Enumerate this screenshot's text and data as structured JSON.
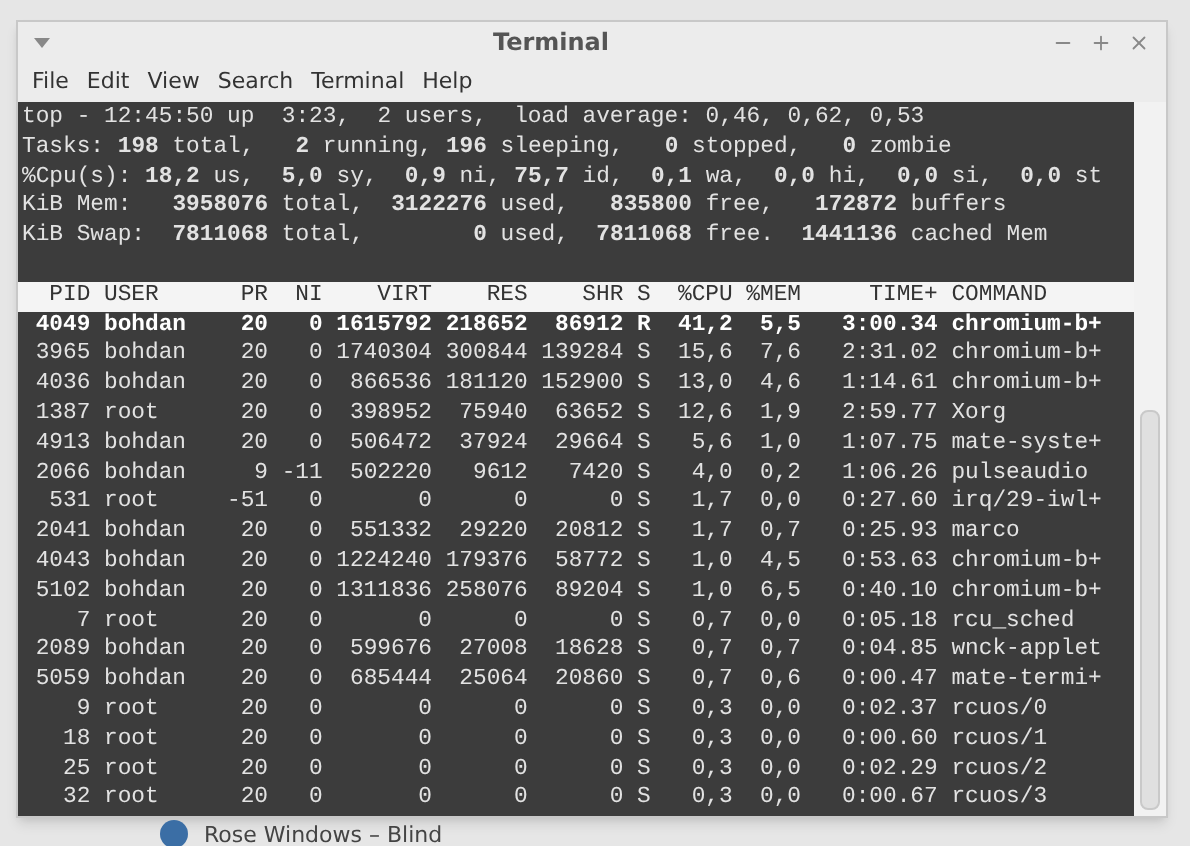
{
  "window": {
    "title": "Terminal"
  },
  "menu": [
    "File",
    "Edit",
    "View",
    "Search",
    "Terminal",
    "Help"
  ],
  "summary": [
    "top - 12:45:50 up  3:23,  2 users,  load average: 0,46, 0,62, 0,53",
    "Tasks: **198** total,   **2** running, **196** sleeping,   **0** stopped,   **0** zombie",
    "%Cpu(s): **18,2** us,  **5,0** sy,  **0,9** ni, **75,7** id,  **0,1** wa,  **0,0** hi,  **0,0** si,  **0,0** st",
    "KiB Mem:   **3958076** total,  **3122276** used,   **835800** free,   **172872** buffers",
    "KiB Swap:  **7811068** total,        **0** used,  **7811068** free.  **1441136** cached Mem"
  ],
  "table": {
    "columns": [
      "PID",
      "USER",
      "PR",
      "NI",
      "VIRT",
      "RES",
      "SHR",
      "S",
      "%CPU",
      "%MEM",
      "TIME+",
      "COMMAND"
    ],
    "rows": [
      {
        "highlighted": true,
        "cells": [
          "4049",
          "bohdan",
          "20",
          "0",
          "1615792",
          "218652",
          "86912",
          "R",
          "41,2",
          "5,5",
          "3:00.34",
          "chromium-b+"
        ]
      },
      {
        "highlighted": false,
        "cells": [
          "3965",
          "bohdan",
          "20",
          "0",
          "1740304",
          "300844",
          "139284",
          "S",
          "15,6",
          "7,6",
          "2:31.02",
          "chromium-b+"
        ]
      },
      {
        "highlighted": false,
        "cells": [
          "4036",
          "bohdan",
          "20",
          "0",
          "866536",
          "181120",
          "152900",
          "S",
          "13,0",
          "4,6",
          "1:14.61",
          "chromium-b+"
        ]
      },
      {
        "highlighted": false,
        "cells": [
          "1387",
          "root",
          "20",
          "0",
          "398952",
          "75940",
          "63652",
          "S",
          "12,6",
          "1,9",
          "2:59.77",
          "Xorg"
        ]
      },
      {
        "highlighted": false,
        "cells": [
          "4913",
          "bohdan",
          "20",
          "0",
          "506472",
          "37924",
          "29664",
          "S",
          "5,6",
          "1,0",
          "1:07.75",
          "mate-syste+"
        ]
      },
      {
        "highlighted": false,
        "cells": [
          "2066",
          "bohdan",
          "9",
          "-11",
          "502220",
          "9612",
          "7420",
          "S",
          "4,0",
          "0,2",
          "1:06.26",
          "pulseaudio"
        ]
      },
      {
        "highlighted": false,
        "cells": [
          "531",
          "root",
          "-51",
          "0",
          "0",
          "0",
          "0",
          "S",
          "1,7",
          "0,0",
          "0:27.60",
          "irq/29-iwl+"
        ]
      },
      {
        "highlighted": false,
        "cells": [
          "2041",
          "bohdan",
          "20",
          "0",
          "551332",
          "29220",
          "20812",
          "S",
          "1,7",
          "0,7",
          "0:25.93",
          "marco"
        ]
      },
      {
        "highlighted": false,
        "cells": [
          "4043",
          "bohdan",
          "20",
          "0",
          "1224240",
          "179376",
          "58772",
          "S",
          "1,0",
          "4,5",
          "0:53.63",
          "chromium-b+"
        ]
      },
      {
        "highlighted": false,
        "cells": [
          "5102",
          "bohdan",
          "20",
          "0",
          "1311836",
          "258076",
          "89204",
          "S",
          "1,0",
          "6,5",
          "0:40.10",
          "chromium-b+"
        ]
      },
      {
        "highlighted": false,
        "cells": [
          "7",
          "root",
          "20",
          "0",
          "0",
          "0",
          "0",
          "S",
          "0,7",
          "0,0",
          "0:05.18",
          "rcu_sched"
        ]
      },
      {
        "highlighted": false,
        "cells": [
          "2089",
          "bohdan",
          "20",
          "0",
          "599676",
          "27008",
          "18628",
          "S",
          "0,7",
          "0,7",
          "0:04.85",
          "wnck-applet"
        ]
      },
      {
        "highlighted": false,
        "cells": [
          "5059",
          "bohdan",
          "20",
          "0",
          "685444",
          "25064",
          "20860",
          "S",
          "0,7",
          "0,6",
          "0:00.47",
          "mate-termi+"
        ]
      },
      {
        "highlighted": false,
        "cells": [
          "9",
          "root",
          "20",
          "0",
          "0",
          "0",
          "0",
          "S",
          "0,3",
          "0,0",
          "0:02.37",
          "rcuos/0"
        ]
      },
      {
        "highlighted": false,
        "cells": [
          "18",
          "root",
          "20",
          "0",
          "0",
          "0",
          "0",
          "S",
          "0,3",
          "0,0",
          "0:00.60",
          "rcuos/1"
        ]
      },
      {
        "highlighted": false,
        "cells": [
          "25",
          "root",
          "20",
          "0",
          "0",
          "0",
          "0",
          "S",
          "0,3",
          "0,0",
          "0:02.29",
          "rcuos/2"
        ]
      },
      {
        "highlighted": false,
        "cells": [
          "32",
          "root",
          "20",
          "0",
          "0",
          "0",
          "0",
          "S",
          "0,3",
          "0,0",
          "0:00.67",
          "rcuos/3"
        ]
      }
    ]
  },
  "background_item": {
    "title": "Rose Windows – Blind"
  }
}
